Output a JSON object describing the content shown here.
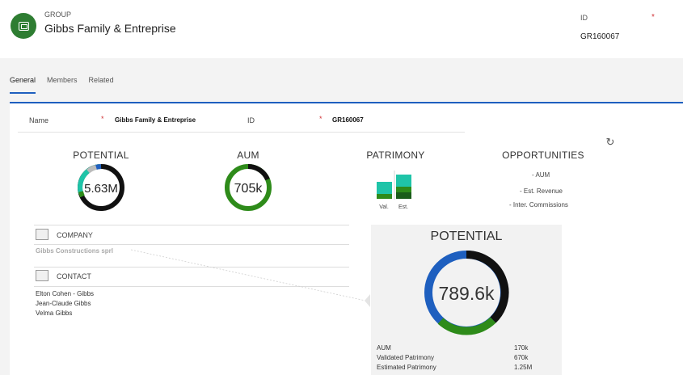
{
  "header": {
    "entity_type": "GROUP",
    "entity_name": "Gibbs Family & Entreprise",
    "id_label": "ID",
    "id_required": "*",
    "id_value": "GR160067"
  },
  "tabs": [
    {
      "label": "General",
      "active": true
    },
    {
      "label": "Members",
      "active": false
    },
    {
      "label": "Related",
      "active": false
    }
  ],
  "form": {
    "name_label": "Name",
    "name_required": "*",
    "name_value": "Gibbs Family & Entreprise",
    "id_label": "ID",
    "id_required": "*",
    "id_value": "GR160067"
  },
  "kpis": {
    "potential": {
      "title": "POTENTIAL",
      "value": "5.63M"
    },
    "aum": {
      "title": "AUM",
      "value": "705k"
    },
    "patrimony": {
      "title": "PATRIMONY",
      "bar_labels": [
        "Val.",
        "Est."
      ]
    },
    "opportunities": {
      "title": "OPPORTUNITIES",
      "legend": [
        "- AUM",
        "- Est. Revenue",
        "- Inter. Commissions"
      ]
    }
  },
  "company": {
    "title": "COMPANY",
    "link": "Gibbs Constructions sprl"
  },
  "contact": {
    "title": "CONTACT",
    "items": [
      "Elton Cohen - Gibbs",
      "Jean-Claude Gibbs",
      "Velma Gibbs"
    ]
  },
  "popup": {
    "title": "POTENTIAL",
    "value": "789.6k",
    "rows": [
      {
        "label": "AUM",
        "value": "170k"
      },
      {
        "label": "Validated Patrimony",
        "value": "670k"
      },
      {
        "label": "Estimated Patrimony",
        "value": "1.25M"
      }
    ]
  },
  "colors": {
    "accent": "#1e5fbf",
    "green": "#2e8b1a",
    "teal": "#1fc4a8",
    "dark": "#111111",
    "blue": "#1e5fbf",
    "required": "#d13438"
  }
}
